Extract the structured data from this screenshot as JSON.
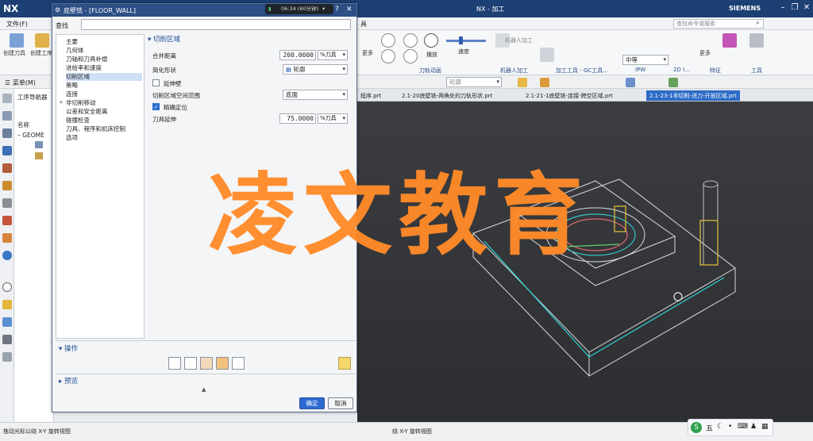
{
  "app": {
    "logo": "NX",
    "title": "NX - 加工",
    "brand": "SIEMENS"
  },
  "menubar": {
    "file": "文件(F)",
    "search_placeholder": "查找命令或搜索"
  },
  "ribbon": {
    "left_btn1": "创建刀具",
    "left_btn2": "创建工序",
    "play": "播放",
    "speed": "速度",
    "more": "更多",
    "robot_machining": "机器人加工",
    "medium": "中等",
    "groups": [
      "刀轨动画",
      "机器人加工",
      "加工工具 - GC工具...",
      "IPW",
      "2D I...",
      "特征",
      "工具"
    ]
  },
  "selbar": {
    "menu": "菜单(M)",
    "filter": "轮廓"
  },
  "doc_tabs": [
    "程序.prt",
    "2.1-20底壁铣-两角处的刀轨形状.prt",
    "2.1-21-1底壁铣-连接-跨空区域.prt",
    "2.1-23-1非切削-进刀-开放区域.prt"
  ],
  "navigator": {
    "title": "工序导航器",
    "col_name": "名称",
    "item": "GEOME"
  },
  "dialog": {
    "title": "底壁铣 - [FLOOR_WALL]",
    "find_label": "查找",
    "nav_items": [
      "主要",
      "几何体",
      "刀轴和刀具补偿",
      "进给率和速度",
      "切削区域",
      "策略",
      "连接",
      "非切削移动",
      "公差和安全距离",
      "碰撞检查",
      "刀具、程序和机床控制",
      "选项"
    ],
    "selected_nav": "切削区域",
    "section_title": "切削区域",
    "merge_distance_label": "合并距离",
    "merge_distance_value": "200.0000",
    "merge_distance_unit": "%刀具",
    "simplify_label": "简化形状",
    "simplify_value": "轮廓",
    "extend_wall_label": "延伸壁",
    "extend_wall_checked": false,
    "space_range_label": "切削区域空间范围",
    "space_range_value": "底面",
    "precise_label": "精确定位",
    "precise_checked": true,
    "tool_ext_label": "刀具延伸",
    "tool_ext_value": "75.0000",
    "tool_ext_unit": "%刀具",
    "ops_title": "操作",
    "preview_title": "预览",
    "ok": "确定",
    "cancel": "取消"
  },
  "recorder": {
    "time": "06:34 (60分钟)"
  },
  "watermark": "凌文教育",
  "status": {
    "left": "拖动光标以绕 X-Y 旋转视图",
    "center": "绕 X-Y 旋转视图"
  },
  "tray": {
    "ime": "五"
  },
  "colors": {
    "titlebar": "#1c3f74",
    "dialog_title": "#2c4f86",
    "watermark": "#ff8a28",
    "viewport": "#35373b"
  }
}
